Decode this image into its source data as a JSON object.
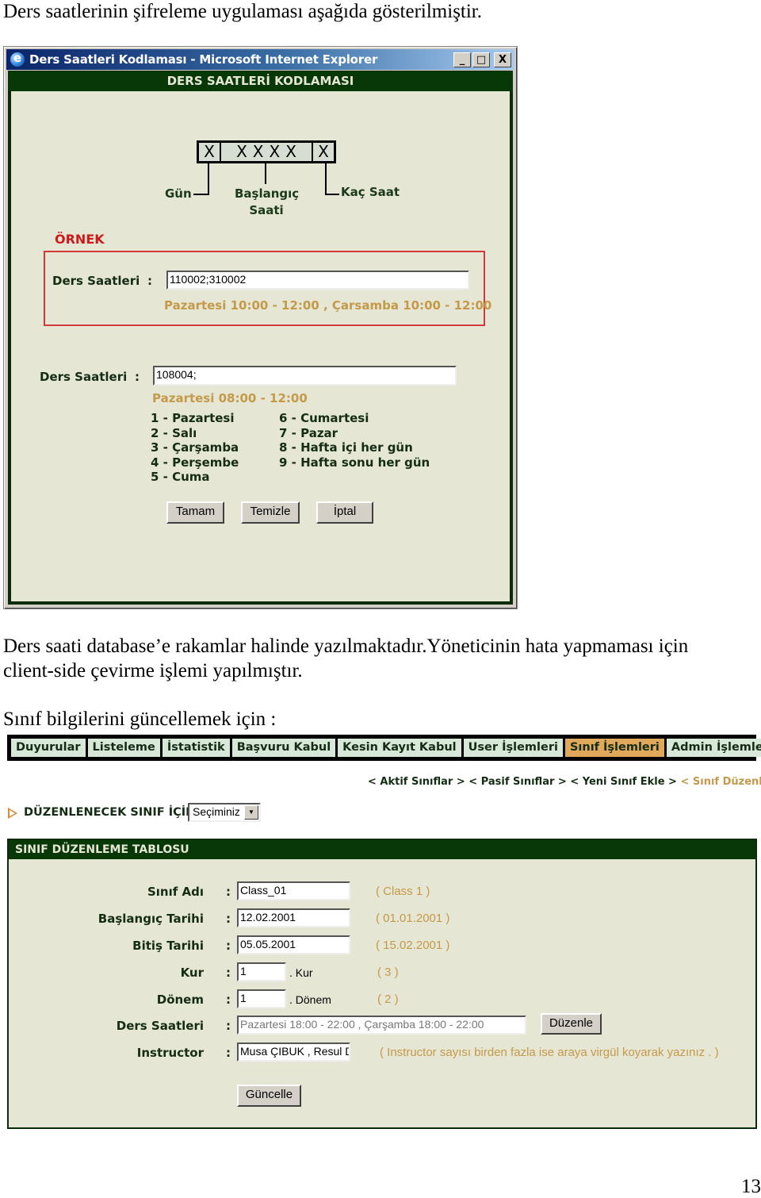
{
  "intro_text": "Ders saatlerinin şifreleme uygulaması aşağıda gösterilmiştir.",
  "ie_window": {
    "title": "Ders Saatleri Kodlaması - Microsoft Internet Explorer",
    "controls": {
      "minimize": "_",
      "maximize": "□",
      "close": "X"
    },
    "header": "DERS SAATLERİ KODLAMASI",
    "code_diagram": {
      "day_cell": "X",
      "start_cells": "XXXX",
      "hours_cell": "X",
      "label_day": "Gün",
      "label_start": "Başlangıç Saati",
      "label_hours": "Kaç Saat"
    },
    "example": {
      "title": "ÖRNEK",
      "label": "Ders Saatleri",
      "colon": ":",
      "input_value": "110002;310002",
      "decoded": "Pazartesi 10:00 - 12:00 , Çarsamba 10:00 - 12:00"
    },
    "form": {
      "label": "Ders Saatleri",
      "colon": ":",
      "input_value": "108004;",
      "decoded": "Pazartesi 08:00 - 12:00",
      "days_left": [
        "1 - Pazartesi",
        "2 - Salı",
        "3 - Çarşamba",
        "4 - Perşembe",
        "5 - Cuma"
      ],
      "days_right": [
        "6 - Cumartesi",
        "7 - Pazar",
        "8 - Hafta içi her gün",
        "9 - Hafta sonu her gün"
      ]
    },
    "buttons": {
      "ok": "Tamam",
      "clear": "Temizle",
      "cancel": "İptal"
    }
  },
  "body_text": {
    "line1": "Ders saati database’e rakamlar halinde yazılmaktadır.Yöneticinin hata yapmaması için",
    "line2": "client-side çevirme işlemi yapılmıştır.",
    "line3": "Sınıf bilgilerini güncellemek için :"
  },
  "class_app": {
    "nav_tabs": [
      {
        "label": "Duyurular",
        "active": false
      },
      {
        "label": "Listeleme",
        "active": false
      },
      {
        "label": "İstatistik",
        "active": false
      },
      {
        "label": "Başvuru Kabul",
        "active": false
      },
      {
        "label": "Kesin Kayıt Kabul",
        "active": false
      },
      {
        "label": "User İşlemleri",
        "active": false
      },
      {
        "label": "Sınıf İşlemleri",
        "active": true
      },
      {
        "label": "Admin İşlemleri",
        "active": false
      }
    ],
    "subnav": {
      "active_classes": "< Aktif Sınıflar >",
      "passive_classes": "< Pasif Sınıflar >",
      "new_class": "< Yeni Sınıf Ekle >",
      "edit_class": "< Sınıf Düzenle >"
    },
    "selector": {
      "label": "DÜZENLENECEK SINIF İÇİN",
      "selected": "Seçiminiz"
    },
    "edit_table": {
      "title": "SINIF DÜZENLEME TABLOSU",
      "colon": ":",
      "fields": {
        "class_name": {
          "label": "Sınıf Adı",
          "value": "Class_01",
          "hint": "( Class 1 )"
        },
        "start_date": {
          "label": "Başlangıç Tarihi",
          "value": "12.02.2001",
          "hint": "( 01.01.2001 )"
        },
        "end_date": {
          "label": "Bitiş Tarihi",
          "value": "05.05.2001",
          "hint": "( 15.02.2001 )"
        },
        "level": {
          "label": "Kur",
          "value": "1",
          "suffix": ". Kur",
          "hint": "( 3 )"
        },
        "term": {
          "label": "Dönem",
          "value": "1",
          "suffix": ". Dönem",
          "hint": "( 2 )"
        },
        "hours": {
          "label": "Ders Saatleri",
          "value": "Pazartesi 18:00 - 22:00 , Çarşamba 18:00 - 22:00",
          "button": "Düzenle"
        },
        "instructor": {
          "label": "Instructor",
          "value": "Musa ÇIBUK , Resul D",
          "hint": "( Instructor sayısı birden fazla ise araya virgül koyarak yazınız . )"
        }
      },
      "update_button": "Güncelle"
    }
  },
  "page_number": "13"
}
